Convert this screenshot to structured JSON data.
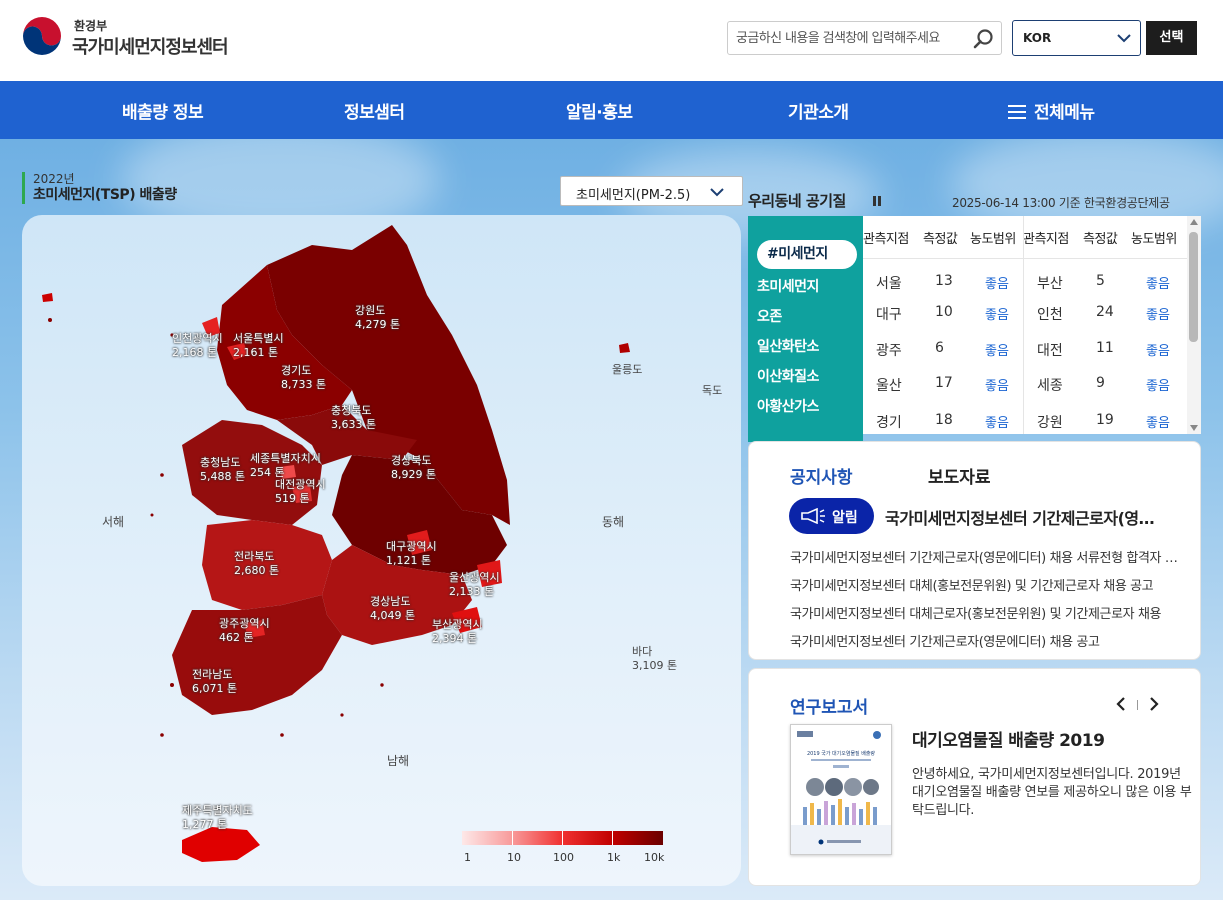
{
  "header": {
    "org": "환경부",
    "title": "국가미세먼지정보센터",
    "search_placeholder": "궁금하신 내용을 검색창에 입력해주세요",
    "lang": "KOR",
    "select_label": "선택"
  },
  "nav": {
    "items": [
      "배출량 정보",
      "정보샘터",
      "알림·홍보",
      "기관소개"
    ],
    "all_menu": "전체메뉴"
  },
  "map": {
    "year": "2022년",
    "title": "초미세먼지(TSP) 배출량",
    "pollutant": "초미세먼지(PM-2.5)",
    "regions": [
      {
        "name": "강원도",
        "value": "4,279 톤"
      },
      {
        "name": "인천광역시",
        "value": "2,168 톤"
      },
      {
        "name": "서울특별시",
        "value": "2,161 톤"
      },
      {
        "name": "경기도",
        "value": "8,733 톤"
      },
      {
        "name": "충청북도",
        "value": "3,633 톤"
      },
      {
        "name": "충청남도",
        "value": "5,488 톤"
      },
      {
        "name": "세종특별자치시",
        "value": "254 톤"
      },
      {
        "name": "대전광역시",
        "value": "519 톤"
      },
      {
        "name": "경상북도",
        "value": "8,929 톤"
      },
      {
        "name": "대구광역시",
        "value": "1,121 톤"
      },
      {
        "name": "전라북도",
        "value": "2,680 톤"
      },
      {
        "name": "울산광역시",
        "value": "2,133 톤"
      },
      {
        "name": "경상남도",
        "value": "4,049 톤"
      },
      {
        "name": "광주광역시",
        "value": "462 톤"
      },
      {
        "name": "부산광역시",
        "value": "2,394 톤"
      },
      {
        "name": "전라남도",
        "value": "6,071 톤"
      },
      {
        "name": "제주특별자치도",
        "value": "1,277 톤"
      }
    ],
    "seas": {
      "west": "서해",
      "east": "동해",
      "south": "남해",
      "ulleung": "울릉도",
      "dokdo": "독도",
      "sea_label": "바다",
      "sea_value": "3,109 톤"
    },
    "legend": [
      "1",
      "10",
      "100",
      "1k",
      "10k"
    ]
  },
  "air": {
    "title": "우리동네 공기질",
    "time": "2025-06-14 13:00 기준 한국환경공단제공",
    "tabs": [
      "#미세먼지",
      "초미세먼지",
      "오존",
      "일산화탄소",
      "이산화질소",
      "아황산가스"
    ],
    "headers": [
      "관측지점",
      "측정값",
      "농도범위",
      "관측지점",
      "측정값",
      "농도범위"
    ],
    "rows": [
      [
        "서울",
        "13",
        "좋음",
        "부산",
        "5",
        "좋음"
      ],
      [
        "대구",
        "10",
        "좋음",
        "인천",
        "24",
        "좋음"
      ],
      [
        "광주",
        "6",
        "좋음",
        "대전",
        "11",
        "좋음"
      ],
      [
        "울산",
        "17",
        "좋음",
        "세종",
        "9",
        "좋음"
      ],
      [
        "경기",
        "18",
        "좋음",
        "강원",
        "19",
        "좋음"
      ]
    ]
  },
  "notice": {
    "tab1": "공지사항",
    "tab2": "보도자료",
    "badge": "알림",
    "headline": "국가미세먼지정보센터 기간제근로자(영문에디터) 채용",
    "items": [
      "국가미세먼지정보센터 기간제근로자(영문에디터) 채용 서류전형 합격자 발표",
      "국가미세먼지정보센터 대체(홍보전문위원) 및 기간제근로자 채용 공고",
      "국가미세먼지정보센터 대체근로자(홍보전문위원) 및 기간제근로자 채용",
      "국가미세먼지정보센터 기간제근로자(영문에디터) 채용 공고"
    ]
  },
  "report": {
    "title": "연구보고서",
    "book_title": "대기오염물질 배출량 2019",
    "body": "안녕하세요, 국가미세먼지정보센터입니다. 2019년 대기오염물질 배출량 연보를 제공하오니 많은 이용 부탁드립니다.",
    "cover_title": "2019 국가 대기오염물질 배출량"
  }
}
